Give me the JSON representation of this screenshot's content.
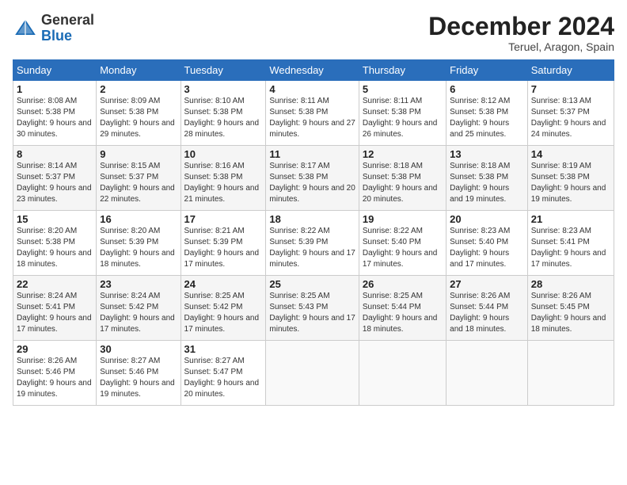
{
  "header": {
    "logo_general": "General",
    "logo_blue": "Blue",
    "month_title": "December 2024",
    "subtitle": "Teruel, Aragon, Spain"
  },
  "days_of_week": [
    "Sunday",
    "Monday",
    "Tuesday",
    "Wednesday",
    "Thursday",
    "Friday",
    "Saturday"
  ],
  "weeks": [
    [
      {
        "day": "1",
        "sunrise": "8:08 AM",
        "sunset": "5:38 PM",
        "daylight": "9 hours and 30 minutes."
      },
      {
        "day": "2",
        "sunrise": "8:09 AM",
        "sunset": "5:38 PM",
        "daylight": "9 hours and 29 minutes."
      },
      {
        "day": "3",
        "sunrise": "8:10 AM",
        "sunset": "5:38 PM",
        "daylight": "9 hours and 28 minutes."
      },
      {
        "day": "4",
        "sunrise": "8:11 AM",
        "sunset": "5:38 PM",
        "daylight": "9 hours and 27 minutes."
      },
      {
        "day": "5",
        "sunrise": "8:11 AM",
        "sunset": "5:38 PM",
        "daylight": "9 hours and 26 minutes."
      },
      {
        "day": "6",
        "sunrise": "8:12 AM",
        "sunset": "5:38 PM",
        "daylight": "9 hours and 25 minutes."
      },
      {
        "day": "7",
        "sunrise": "8:13 AM",
        "sunset": "5:37 PM",
        "daylight": "9 hours and 24 minutes."
      }
    ],
    [
      {
        "day": "8",
        "sunrise": "8:14 AM",
        "sunset": "5:37 PM",
        "daylight": "9 hours and 23 minutes."
      },
      {
        "day": "9",
        "sunrise": "8:15 AM",
        "sunset": "5:37 PM",
        "daylight": "9 hours and 22 minutes."
      },
      {
        "day": "10",
        "sunrise": "8:16 AM",
        "sunset": "5:38 PM",
        "daylight": "9 hours and 21 minutes."
      },
      {
        "day": "11",
        "sunrise": "8:17 AM",
        "sunset": "5:38 PM",
        "daylight": "9 hours and 20 minutes."
      },
      {
        "day": "12",
        "sunrise": "8:18 AM",
        "sunset": "5:38 PM",
        "daylight": "9 hours and 20 minutes."
      },
      {
        "day": "13",
        "sunrise": "8:18 AM",
        "sunset": "5:38 PM",
        "daylight": "9 hours and 19 minutes."
      },
      {
        "day": "14",
        "sunrise": "8:19 AM",
        "sunset": "5:38 PM",
        "daylight": "9 hours and 19 minutes."
      }
    ],
    [
      {
        "day": "15",
        "sunrise": "8:20 AM",
        "sunset": "5:38 PM",
        "daylight": "9 hours and 18 minutes."
      },
      {
        "day": "16",
        "sunrise": "8:20 AM",
        "sunset": "5:39 PM",
        "daylight": "9 hours and 18 minutes."
      },
      {
        "day": "17",
        "sunrise": "8:21 AM",
        "sunset": "5:39 PM",
        "daylight": "9 hours and 17 minutes."
      },
      {
        "day": "18",
        "sunrise": "8:22 AM",
        "sunset": "5:39 PM",
        "daylight": "9 hours and 17 minutes."
      },
      {
        "day": "19",
        "sunrise": "8:22 AM",
        "sunset": "5:40 PM",
        "daylight": "9 hours and 17 minutes."
      },
      {
        "day": "20",
        "sunrise": "8:23 AM",
        "sunset": "5:40 PM",
        "daylight": "9 hours and 17 minutes."
      },
      {
        "day": "21",
        "sunrise": "8:23 AM",
        "sunset": "5:41 PM",
        "daylight": "9 hours and 17 minutes."
      }
    ],
    [
      {
        "day": "22",
        "sunrise": "8:24 AM",
        "sunset": "5:41 PM",
        "daylight": "9 hours and 17 minutes."
      },
      {
        "day": "23",
        "sunrise": "8:24 AM",
        "sunset": "5:42 PM",
        "daylight": "9 hours and 17 minutes."
      },
      {
        "day": "24",
        "sunrise": "8:25 AM",
        "sunset": "5:42 PM",
        "daylight": "9 hours and 17 minutes."
      },
      {
        "day": "25",
        "sunrise": "8:25 AM",
        "sunset": "5:43 PM",
        "daylight": "9 hours and 17 minutes."
      },
      {
        "day": "26",
        "sunrise": "8:25 AM",
        "sunset": "5:44 PM",
        "daylight": "9 hours and 18 minutes."
      },
      {
        "day": "27",
        "sunrise": "8:26 AM",
        "sunset": "5:44 PM",
        "daylight": "9 hours and 18 minutes."
      },
      {
        "day": "28",
        "sunrise": "8:26 AM",
        "sunset": "5:45 PM",
        "daylight": "9 hours and 18 minutes."
      }
    ],
    [
      {
        "day": "29",
        "sunrise": "8:26 AM",
        "sunset": "5:46 PM",
        "daylight": "9 hours and 19 minutes."
      },
      {
        "day": "30",
        "sunrise": "8:27 AM",
        "sunset": "5:46 PM",
        "daylight": "9 hours and 19 minutes."
      },
      {
        "day": "31",
        "sunrise": "8:27 AM",
        "sunset": "5:47 PM",
        "daylight": "9 hours and 20 minutes."
      },
      null,
      null,
      null,
      null
    ]
  ],
  "labels": {
    "sunrise_prefix": "Sunrise: ",
    "sunset_prefix": "Sunset: ",
    "daylight_prefix": "Daylight: "
  }
}
